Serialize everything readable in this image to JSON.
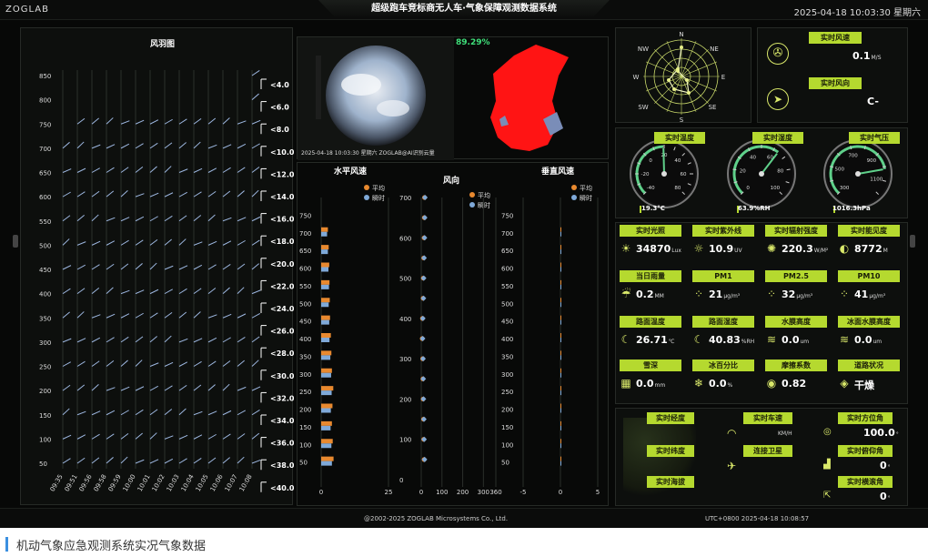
{
  "header": {
    "brand": "ZOGLAB",
    "title": "超级跑车竞标商无人车·气象保障观测数据系统",
    "clock": "2025-04-18 10:03:30 星期六"
  },
  "wind_barbs": {
    "title": "风羽图",
    "y_ticks": [
      "850",
      "800",
      "750",
      "700",
      "650",
      "600",
      "550",
      "500",
      "450",
      "400",
      "350",
      "300",
      "250",
      "200",
      "150",
      "100",
      "50"
    ],
    "x_ticks": [
      "09:35",
      "09:51",
      "09:56",
      "09:58",
      "09:59",
      "10:00",
      "10:01",
      "10:02",
      "10:03",
      "10:04",
      "10:05",
      "10:06",
      "10:07",
      "10:08"
    ],
    "legend": [
      "<4.0",
      "<6.0",
      "<8.0",
      "<10.0",
      "<12.0",
      "<14.0",
      "<16.0",
      "<18.0",
      "<20.0",
      "<22.0",
      "<24.0",
      "<26.0",
      "<28.0",
      "<30.0",
      "<32.0",
      "<34.0",
      "<36.0",
      "<38.0",
      "<40.0"
    ]
  },
  "sky": {
    "cloud_percent": "89.29%",
    "caption": "2025-04-18 10:03:30  星期六   ZOGLAB@AI识别云量"
  },
  "chart_data": [
    {
      "type": "bar",
      "title": "水平风速",
      "legend": [
        "平均",
        "瞬时"
      ],
      "y_ticks": [
        "750",
        "700",
        "650",
        "600",
        "550",
        "500",
        "450",
        "400",
        "350",
        "300",
        "250",
        "200",
        "150",
        "100",
        "50"
      ],
      "x_ticks": [
        "0",
        "25"
      ],
      "heights": [
        700,
        650,
        600,
        550,
        500,
        450,
        400,
        350,
        300,
        250,
        200,
        150,
        100,
        50
      ],
      "series": [
        {
          "name": "平均",
          "values": [
            2.5,
            2.8,
            3.0,
            3.1,
            3.2,
            3.3,
            3.6,
            3.8,
            4.0,
            4.5,
            4.2,
            4.0,
            4.3,
            4.6
          ]
        },
        {
          "name": "瞬时",
          "values": [
            2.2,
            2.5,
            2.7,
            2.9,
            2.8,
            3.0,
            3.1,
            3.4,
            3.7,
            3.9,
            3.6,
            3.5,
            3.8,
            4.0
          ]
        }
      ]
    },
    {
      "type": "scatter",
      "title": "风向",
      "legend": [
        "平均",
        "瞬时"
      ],
      "y_ticks": [
        "700",
        "600",
        "500",
        "400",
        "300",
        "200",
        "100",
        "0"
      ],
      "x_ticks": [
        "0",
        "100",
        "200",
        "300",
        "360"
      ],
      "heights": [
        700,
        650,
        600,
        550,
        500,
        450,
        400,
        350,
        300,
        250,
        200,
        150,
        100,
        50
      ],
      "series": [
        {
          "name": "平均",
          "values": [
            16,
            15,
            14,
            12,
            10,
            9,
            6,
            5,
            7,
            8,
            9,
            11,
            12,
            14
          ]
        },
        {
          "name": "瞬时",
          "values": [
            18,
            17,
            16,
            14,
            12,
            11,
            8,
            7,
            9,
            10,
            11,
            13,
            14,
            16
          ]
        }
      ]
    },
    {
      "type": "bar",
      "title": "垂直风速",
      "legend": [
        "平均",
        "瞬时"
      ],
      "y_ticks": [
        "750",
        "700",
        "650",
        "600",
        "550",
        "500",
        "450",
        "400",
        "350",
        "300",
        "250",
        "200",
        "150",
        "100",
        "50"
      ],
      "x_ticks": [
        "-5",
        "0",
        "5"
      ],
      "heights": [
        700,
        650,
        600,
        550,
        500,
        450,
        400,
        350,
        300,
        250,
        200,
        150,
        100,
        50
      ],
      "series": [
        {
          "name": "平均",
          "values": [
            0.05,
            0.04,
            0.03,
            0.03,
            0.02,
            0.02,
            0.02,
            0.01,
            0.01,
            0.01,
            0.01,
            0.01,
            0.01,
            0.01
          ]
        },
        {
          "name": "瞬时",
          "values": [
            0.08,
            0.07,
            0.05,
            0.04,
            0.03,
            0.03,
            0.02,
            0.02,
            0.02,
            0.01,
            0.01,
            0.01,
            0.01,
            0.01
          ]
        }
      ]
    }
  ],
  "compass": {
    "n": "N",
    "ne": "NE",
    "e": "E",
    "se": "SE",
    "s": "S",
    "sw": "SW",
    "w": "W",
    "nw": "NW"
  },
  "wind_now": {
    "speed_label": "实时风速",
    "speed_value": "0.1",
    "speed_unit": "M/S",
    "dir_label": "实时风向",
    "dir_value": "C-"
  },
  "gauges": {
    "temp": {
      "label": "实时温度",
      "readout": "19.3°C",
      "value": 19.3,
      "min": -40,
      "max": 80,
      "ticks": [
        "-40",
        "-30",
        "-20",
        "-10",
        "0",
        "10",
        "20",
        "30",
        "40",
        "50",
        "60",
        "70",
        "80"
      ]
    },
    "hum": {
      "label": "实时湿度",
      "readout": "63.9%RH",
      "value": 63.9,
      "min": 0,
      "max": 100,
      "ticks": [
        "0",
        "10",
        "20",
        "30",
        "40",
        "50",
        "60",
        "70",
        "80",
        "90",
        "100"
      ]
    },
    "press": {
      "label": "实时气压",
      "readout": "1016.3hPa",
      "value": 1016.3,
      "min": 300,
      "max": 1200,
      "ticks": [
        "300",
        "400",
        "500",
        "600",
        "700",
        "800",
        "900",
        "1000",
        "1100",
        "1200"
      ]
    }
  },
  "metrics": [
    {
      "label": "实时光照",
      "value": "34870",
      "unit": "Lux",
      "icon": "sun-icon",
      "glyph": "☀"
    },
    {
      "label": "实时紫外线",
      "value": "10.9",
      "unit": "UV",
      "icon": "uv-icon",
      "glyph": "☼"
    },
    {
      "label": "实时辐射强度",
      "value": "220.3",
      "unit": "W/M²",
      "icon": "radiation-icon",
      "glyph": "✺"
    },
    {
      "label": "实时能见度",
      "value": "8772",
      "unit": "M",
      "icon": "visibility-icon",
      "glyph": "◐"
    },
    {
      "label": "当日雨量",
      "value": "0.2",
      "unit": "MM",
      "icon": "rain-icon",
      "glyph": "☔"
    },
    {
      "label": "PM1",
      "value": "21",
      "unit": "μg/m³",
      "icon": "pm1-icon",
      "glyph": "⁘"
    },
    {
      "label": "PM2.5",
      "value": "32",
      "unit": "μg/m³",
      "icon": "pm25-icon",
      "glyph": "⁘"
    },
    {
      "label": "PM10",
      "value": "41",
      "unit": "μg/m³",
      "icon": "pm10-icon",
      "glyph": "⁘"
    },
    {
      "label": "路面温度",
      "value": "26.71",
      "unit": "℃",
      "icon": "road-temp-icon",
      "glyph": "☾"
    },
    {
      "label": "路面湿度",
      "value": "40.83",
      "unit": "%RH",
      "icon": "road-hum-icon",
      "glyph": "☾"
    },
    {
      "label": "水膜高度",
      "value": "0.0",
      "unit": "um",
      "icon": "water-film-icon",
      "glyph": "≋"
    },
    {
      "label": "冰面水膜高度",
      "value": "0.0",
      "unit": "um",
      "icon": "ice-water-icon",
      "glyph": "≋"
    },
    {
      "label": "雪深",
      "value": "0.0",
      "unit": "mm",
      "icon": "snow-depth-icon",
      "glyph": "▦"
    },
    {
      "label": "冰百分比",
      "value": "0.0",
      "unit": "%",
      "icon": "ice-percent-icon",
      "glyph": "❄"
    },
    {
      "label": "摩擦系数",
      "value": "0.82",
      "unit": "",
      "icon": "friction-icon",
      "glyph": "◉"
    },
    {
      "label": "道路状况",
      "value": "干燥",
      "unit": "",
      "icon": "road-status-icon",
      "glyph": "◈"
    }
  ],
  "gps": {
    "lon_label": "实时经度",
    "lat_label": "实时纬度",
    "alt_label": "实时海拔",
    "speed_label": "实时车速",
    "speed_unit": "KM/H",
    "sat_label": "连接卫星",
    "heading_label": "实时方位角",
    "heading_value": "100.0",
    "heading_unit": "°",
    "pitch_label": "实时俯仰角",
    "pitch_value": "0",
    "pitch_unit": "°",
    "roll_label": "实时横滚角",
    "roll_value": "0",
    "roll_unit": "°"
  },
  "footer": {
    "center": "@2002-2025 ZOGLAB Microsystems Co., Ltd.",
    "right": "UTC+0800 2025-04-18 10:08:57"
  },
  "caption": "机动气象应急观测系统实况气象数据",
  "colors": {
    "accent": "#b5d92f",
    "avg": "#e8892f",
    "inst": "#7fa9d8",
    "cloud": "#ff1414"
  }
}
